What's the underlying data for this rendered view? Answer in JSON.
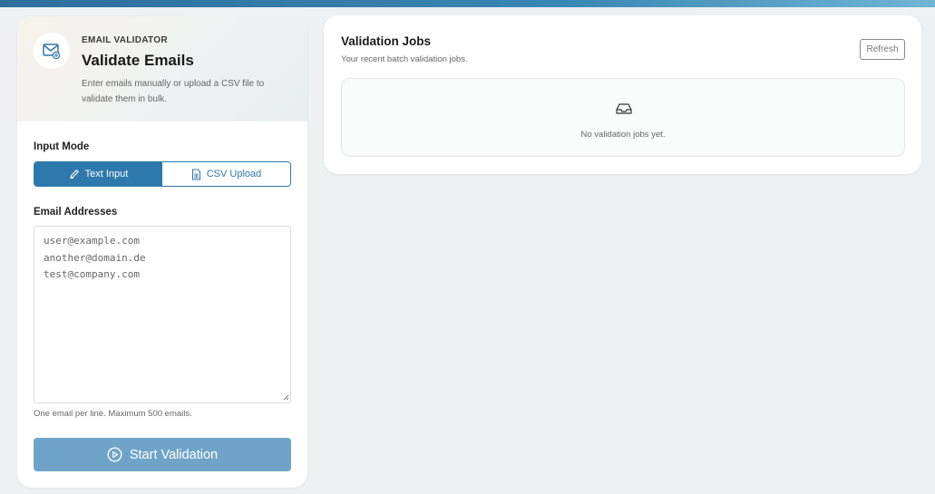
{
  "validator": {
    "eyebrow": "EMAIL VALIDATOR",
    "title": "Validate Emails",
    "description": "Enter emails manually or upload a CSV file to validate them in bulk.",
    "input_mode_label": "Input Mode",
    "modes": [
      {
        "label": "Text Input",
        "icon": "pencil-icon",
        "active": true
      },
      {
        "label": "CSV Upload",
        "icon": "file-csv-icon",
        "active": false
      }
    ],
    "email_label": "Email Addresses",
    "email_placeholder": "user@example.com\nanother@domain.de\ntest@company.com",
    "hint": "One email per line. Maximum 500 emails.",
    "start_button": "Start Validation"
  },
  "jobs": {
    "title": "Validation Jobs",
    "subtitle": "Your recent batch validation jobs.",
    "refresh_button": "Refresh",
    "empty_text": "No validation jobs yet."
  },
  "colors": {
    "accent": "#2e79ab",
    "accent_disabled": "#6fa4c8",
    "background": "#eef0f2"
  }
}
